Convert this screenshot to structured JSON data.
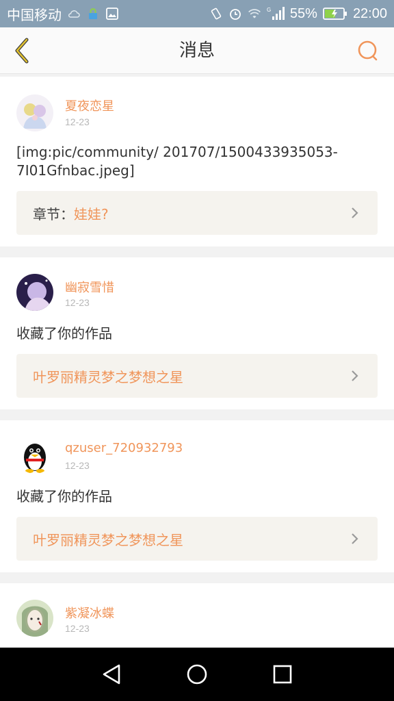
{
  "statusbar": {
    "carrier": "中国移动",
    "battery": "55%",
    "time": "22:00",
    "signal_label": "G"
  },
  "header": {
    "title": "消息"
  },
  "messages": [
    {
      "username": "夏夜恋星",
      "date": "12-23",
      "content": "[img:pic/community/ 201707/1500433935053-7I01Gfnbac.jpeg]",
      "ref_label": "章节：",
      "ref_title": "娃娃?"
    },
    {
      "username": "幽寂雪惜",
      "date": "12-23",
      "content": "收藏了你的作品",
      "ref_label": "",
      "ref_title": "叶罗丽精灵梦之梦想之星"
    },
    {
      "username": "qzuser_720932793",
      "date": "12-23",
      "content": "收藏了你的作品",
      "ref_label": "",
      "ref_title": "叶罗丽精灵梦之梦想之星"
    },
    {
      "username": "紫凝冰蝶",
      "date": "12-23"
    }
  ],
  "colors": {
    "accent": "#f0955a",
    "statusbar": "#88a0b4",
    "ref_bg": "#f5f3ee"
  }
}
